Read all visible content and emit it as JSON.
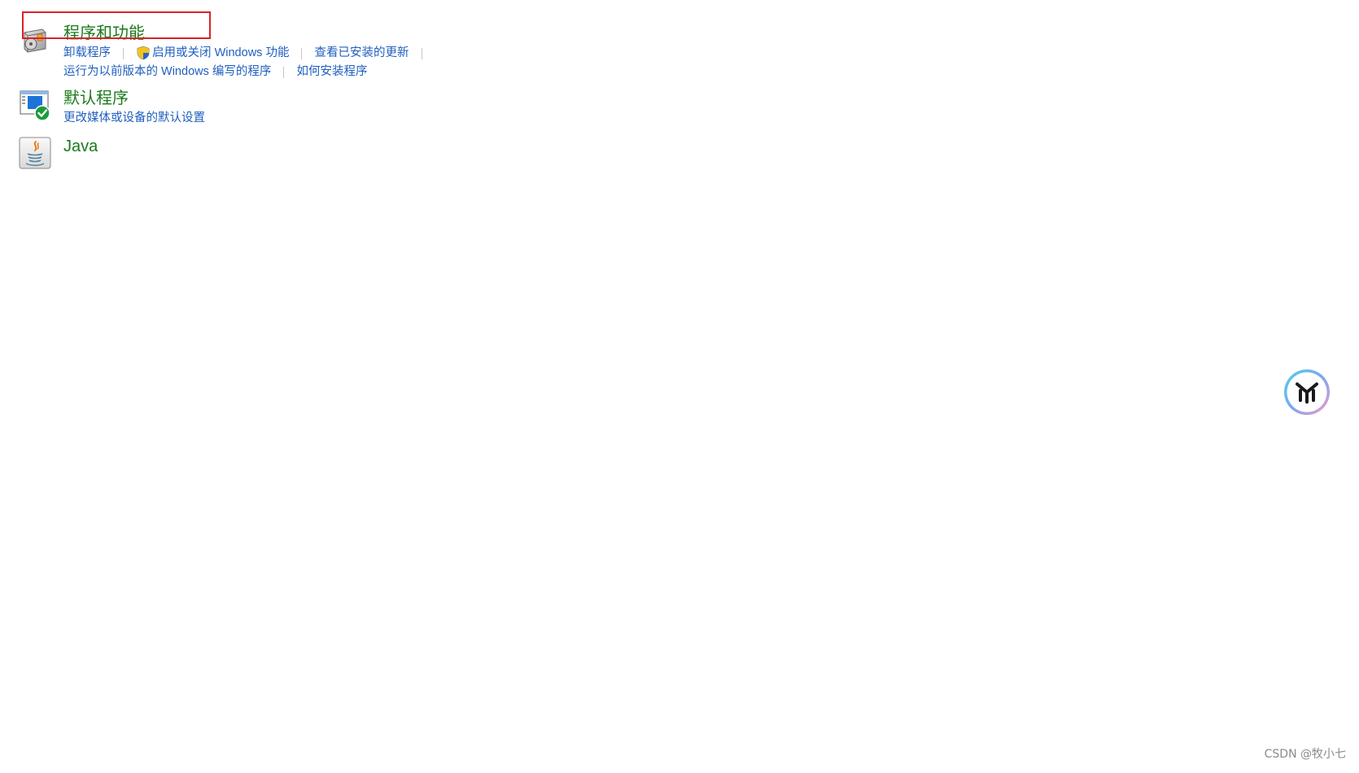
{
  "sections": [
    {
      "title": "程序和功能",
      "links": [
        [
          "卸载程序",
          "启用或关闭 Windows 功能",
          "查看已安装的更新"
        ],
        [
          "运行为以前版本的 Windows 编写的程序",
          "如何安装程序"
        ]
      ]
    },
    {
      "title": "默认程序",
      "links": [
        [
          "更改媒体或设备的默认设置"
        ]
      ]
    },
    {
      "title": "Java",
      "links": []
    }
  ],
  "watermark": "CSDN @牧小七",
  "colors": {
    "title_green": "#1a7a1a",
    "link_blue": "#1f5fbf",
    "highlight_red": "#d9222a"
  }
}
